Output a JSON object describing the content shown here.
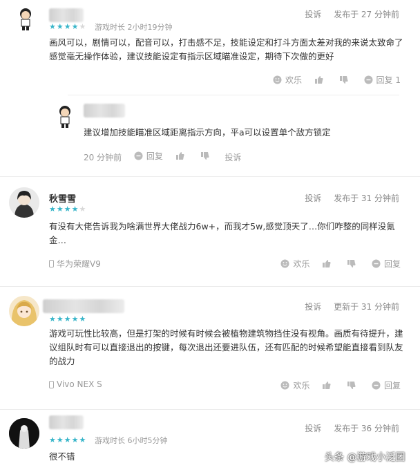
{
  "labels": {
    "report": "投诉",
    "happy": "欢乐",
    "reply": "回复"
  },
  "reviews": [
    {
      "stars": 4,
      "playtime": "游戏时长 2小时19分钟",
      "posted": "发布于 27 分钟前",
      "text": "画风可以，剧情可以，配音可以，打击感不足，技能设定和打斗方面太差对我的来说太致命了感觉毫无操作体验，建议技能设定有指示区域瞄准设定，期待下次做的更好",
      "reply_count": "回复 1",
      "sub_reply": {
        "text": "建议增加技能瞄准区域距离指示方向，平a可以设置单个敌方锁定",
        "time": "20 分钟前"
      }
    },
    {
      "name": "秋雪雪",
      "stars": 4,
      "posted": "发布于 31 分钟前",
      "text": "有没有大佬告诉我为啥满世界大佬战力6w+，而我才5w,感觉顶天了…你们咋整的同样没氪金…",
      "device": "华为荣耀V9"
    },
    {
      "stars": 5,
      "posted": "更新于 31 分钟前",
      "text": "游戏可玩性比较高，但是打架的时候有时候会被植物建筑物挡住没有视角。画质有待提升，建议组队时有可以直接退出的按键，每次退出还要进队伍，还有匹配的时候希望能直接看到队友的战力",
      "device": "Vivo NEX S"
    },
    {
      "stars": 5,
      "playtime": "游戏时长 6小时5分钟",
      "posted": "发布于 36 分钟前",
      "text": "很不错"
    }
  ],
  "watermark": "头条 @游戏小泛团",
  "colors": {
    "star": "#37b5c9",
    "muted": "#999999"
  }
}
